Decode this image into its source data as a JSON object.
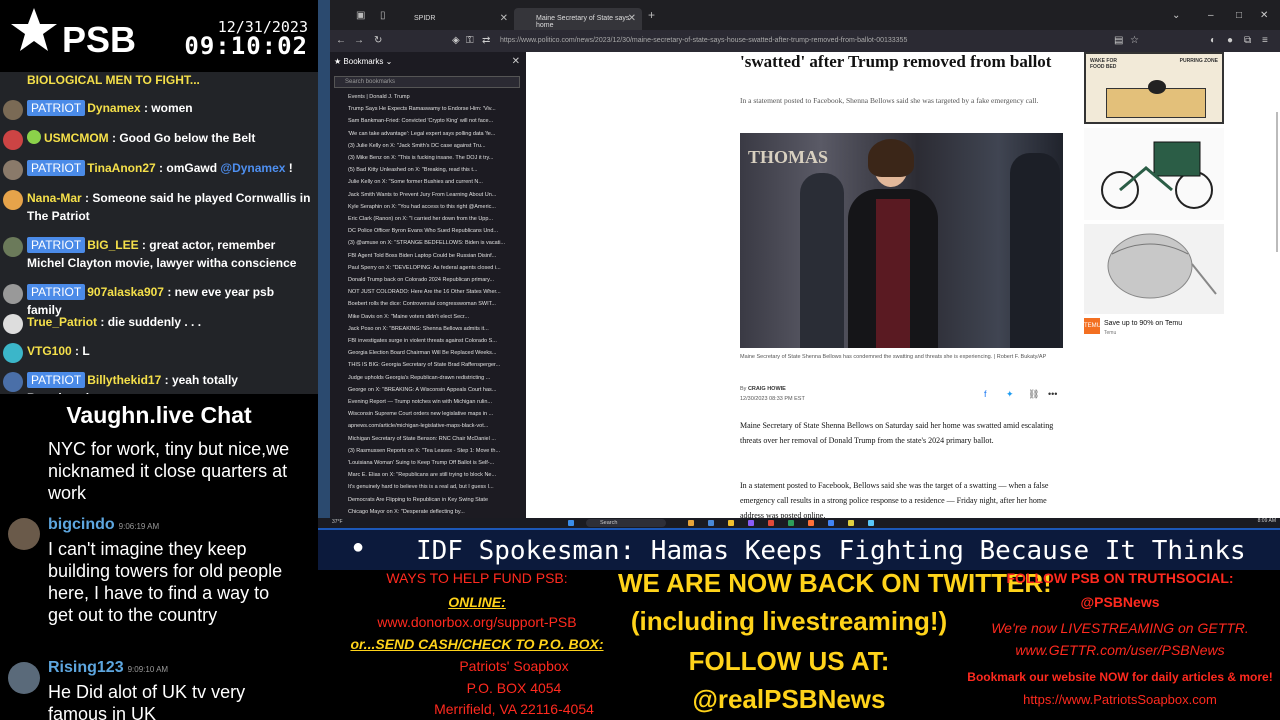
{
  "header": {
    "logo_text": "PSB",
    "date": "12/31/2023",
    "time": "09:10:02"
  },
  "rumble_chat": {
    "partial_top": "BIOLOGICAL MEN TO FIGHT...",
    "messages": [
      {
        "badge": "PATRIOT",
        "user": "Dynamex",
        "text": "women"
      },
      {
        "badge": "",
        "user": "USMCMOM",
        "text": "Good Go below the Belt"
      },
      {
        "badge": "PATRIOT",
        "user": "TinaAnon27",
        "text": "omGawd",
        "mention": "@Dynamex",
        "suffix": "!"
      },
      {
        "badge": "",
        "user": "Nana-Mar",
        "text": "Someone said he played Cornwallis in The Patriot"
      },
      {
        "badge": "PATRIOT",
        "user": "BIG_LEE",
        "text": "great actor, remember Michel Clayton movie, lawyer witha conscience"
      },
      {
        "badge": "PATRIOT",
        "user": "907alaska907",
        "text": "new eve year psb family"
      },
      {
        "badge": "",
        "user": "True_Patriot",
        "text": "die suddenly . . ."
      },
      {
        "badge": "",
        "user": "VTG100",
        "text": "L"
      },
      {
        "badge": "PATRIOT",
        "user": "Billythekid17",
        "text": "yeah totally Broadcasting"
      }
    ]
  },
  "vaughn_chat": {
    "title": "Vaughn.live Chat",
    "first_text": "NYC for work, tiny but nice,we nicknamed it close quarters at work",
    "messages": [
      {
        "user": "bigcindo",
        "time": "9:06:19 AM",
        "text": "I can't imagine they keep building towers for old people here, I have to find a way to get out to the country"
      },
      {
        "user": "Rising123",
        "time": "9:09:10 AM",
        "text": "He Did alot of UK tv very famous in UK"
      }
    ]
  },
  "browser": {
    "tabs": [
      {
        "label": "SPIDR",
        "active": false
      },
      {
        "label": "Maine Secretary of State says home",
        "active": true
      }
    ],
    "url": "https://www.politico.com/news/2023/12/30/maine-secretary-of-state-says-house-swatted-after-trump-removed-from-ballot-00133355",
    "bookmarks": {
      "header": "Bookmarks",
      "search_placeholder": "Search bookmarks",
      "items": [
        "Events | Donald J. Trump",
        "Trump Says He Expects Ramaswamy to Endorse Him: 'Viv...",
        "Sam Bankman-Fried: Convicted 'Crypto King' will not face...",
        "'We can take advantage': Legal expert says polling data 'fe...",
        "(3) Julie Kelly on X: \"Jack Smith's DC case against Tru...",
        "(3) Mike Benz on X: \"This is fucking insane. The DOJ it try...",
        "(5) Bad Kitty Unleashed on X: \"Breaking, read this t...",
        "Julie Kelly on X: \"Some former Bushies and current N...",
        "Jack Smith Wants to Prevent Jury From Learning About Un...",
        "Kyle Seraphin on X: \"You had access to this right @Americ...",
        "Eric Clark (Ranon) on X: \"I carried her down from the Upp...",
        "DC Police Officer Byron Evans Who Sued Republicans Und...",
        "(3) @amuse on X: \"STRANGE BEDFELLOWS: Biden is vacati...",
        "FBI Agent Told Boss Biden Laptop Could be Russian Disinf...",
        "Paul Sperry on X: \"DEVELOPING: As federal agents closed i...",
        "Donald Trump back on Colorado 2024 Republican primary...",
        "NOT JUST COLORADO: Here Are the 16 Other States Wher...",
        "Boebert rolls the dice: Controversial congresswoman SWIT...",
        "Mike Davis on X: \"Maine voters didn't elect Secr...",
        "Jack Poso on X: \"BREAKING: Shenna Bellows admits it...",
        "FBI investigates surge in violent threats against Colorado S...",
        "Georgia Election Board Chairman Will Be Replaced Weeks...",
        "THIS IS BIG: Georgia Secretary of State Brad Raffensperger...",
        "Judge upholds Georgia's Republican-drawn redistricting ...",
        "George on X: \"BREAKING: A Wisconsin Appeals Court has...",
        "Evening Report — Trump notches win with Michigan rulin...",
        "Wisconsin Supreme Court orders new legislative maps in ...",
        "apnews.com/article/michigan-legislative-maps-black-vot...",
        "Michigan Secretary of State Benson: RNC Chair McDaniel ...",
        "(3) Rasmussen Reports on X: \"Tea Leaves - Step 1: Move th...",
        "'Louisiana Woman' Suing to Keep Trump Off Ballot is Self-...",
        "Marc E. Elias on X: \"Republicans are still trying to block Ne...",
        "It's genuinely hard to believe this is a real ad, but I guess I...",
        "Democrats Are Flipping to Republican in Key Swing State",
        "Chicago Mayor on X: \"Desperate deflecting by..."
      ]
    },
    "article": {
      "title": "'swatted' after Trump removed from ballot",
      "subtitle": "In a statement posted to Facebook, Shenna Bellows said she was targeted by a fake emergency call.",
      "caption": "Maine Secretary of State Shenna Bellows has condemned the swatting and threats she is experiencing. | Robert F. Bukaty/AP",
      "by_label": "By",
      "author": "CRAIG HOWIE",
      "date": "12/30/2023 08:33 PM EST",
      "paragraphs": [
        "Maine Secretary of State Shenna Bellows on Saturday said her home was swatted amid escalating threats over her removal of Donald Trump from the state's 2024 primary ballot.",
        "In a statement posted to Facebook, Bellows said she was the target of a swatting — when a false emergency call results in a strong police response to a residence — Friday night, after her home address was posted online."
      ],
      "photo_sign": "THOMAS"
    },
    "ads": {
      "ad1_text": "WAKE FOR FOOD BED",
      "ad1_text2": "PURRING ZONE",
      "temu_text": "Save up to 90% on Temu",
      "temu_brand": "Temu",
      "temu_logo": "TEMU"
    }
  },
  "taskbar": {
    "search_placeholder": "Search",
    "temp": "37°F",
    "time": "8:09 AM"
  },
  "ticker": {
    "bullet": "●",
    "text": "IDF Spokesman: Hamas Keeps Fighting Because It Thinks"
  },
  "banner": {
    "left": {
      "heading": "WAYS TO HELP FUND PSB:",
      "online": "ONLINE:",
      "donor_url": "www.donorbox.org/support-PSB",
      "or_send": "or...SEND CASH/CHECK TO P.O. BOX:",
      "po_name": "Patriots' Soapbox",
      "po_box": "P.O. BOX 4054",
      "po_city": "Merrifield, VA 22116-4054"
    },
    "center": {
      "line1": "WE ARE NOW BACK ON TWITTER!",
      "line2": "(including livestreaming!)",
      "line3": "FOLLOW US AT:",
      "line4": "@realPSBNews"
    },
    "right": {
      "line1": "FOLLOW PSB ON TRUTHSOCIAL:",
      "line2": "@PSBNews",
      "line3": "We're now LIVESTREAMING on GETTR.",
      "line4": "www.GETTR.com/user/PSBNews",
      "line5": "Bookmark our website NOW for daily articles & more!",
      "line6": "https://www.PatriotsSoapbox.com"
    }
  }
}
